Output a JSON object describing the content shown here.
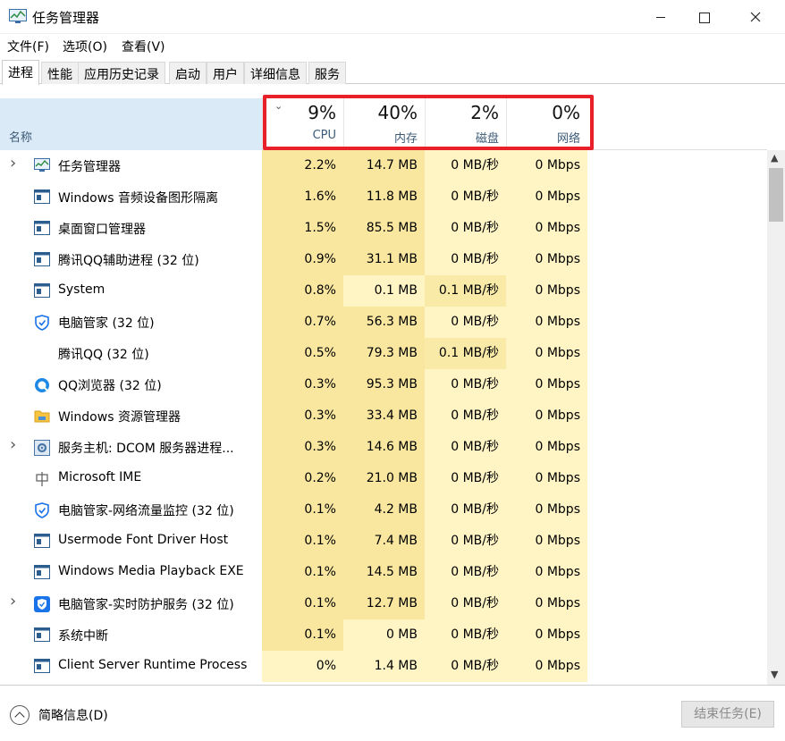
{
  "window": {
    "title": "任务管理器"
  },
  "menu": [
    "文件(F)",
    "选项(O)",
    "查看(V)"
  ],
  "tabs": [
    "进程",
    "性能",
    "应用历史记录",
    "启动",
    "用户",
    "详细信息",
    "服务"
  ],
  "active_tab": "进程",
  "columns": {
    "name": "名称",
    "cpu": {
      "percent": "9%",
      "label": "CPU"
    },
    "memory": {
      "percent": "40%",
      "label": "内存"
    },
    "disk": {
      "percent": "2%",
      "label": "磁盘"
    },
    "network": {
      "percent": "0%",
      "label": "网络"
    }
  },
  "processes": [
    {
      "name": "任务管理器",
      "icon": "task-manager-icon",
      "expandable": true,
      "cpu": "2.2%",
      "mem": "14.7 MB",
      "disk": "0 MB/秒",
      "net": "0 Mbps"
    },
    {
      "name": "Windows 音频设备图形隔离",
      "icon": "app-window-icon",
      "expandable": false,
      "cpu": "1.6%",
      "mem": "11.8 MB",
      "disk": "0 MB/秒",
      "net": "0 Mbps"
    },
    {
      "name": "桌面窗口管理器",
      "icon": "app-window-icon",
      "expandable": false,
      "cpu": "1.5%",
      "mem": "85.5 MB",
      "disk": "0 MB/秒",
      "net": "0 Mbps"
    },
    {
      "name": "腾讯QQ辅助进程 (32 位)",
      "icon": "app-window-icon",
      "expandable": false,
      "cpu": "0.9%",
      "mem": "31.1 MB",
      "disk": "0 MB/秒",
      "net": "0 Mbps"
    },
    {
      "name": "System",
      "icon": "app-window-icon",
      "expandable": false,
      "cpu": "0.8%",
      "mem": "0.1 MB",
      "disk": "0.1 MB/秒",
      "net": "0 Mbps"
    },
    {
      "name": "电脑管家 (32 位)",
      "icon": "shield-icon",
      "expandable": false,
      "cpu": "0.7%",
      "mem": "56.3 MB",
      "disk": "0 MB/秒",
      "net": "0 Mbps"
    },
    {
      "name": "腾讯QQ (32 位)",
      "icon": "",
      "expandable": false,
      "cpu": "0.5%",
      "mem": "79.3 MB",
      "disk": "0.1 MB/秒",
      "net": "0 Mbps"
    },
    {
      "name": "QQ浏览器 (32 位)",
      "icon": "browser-icon",
      "expandable": false,
      "cpu": "0.3%",
      "mem": "95.3 MB",
      "disk": "0 MB/秒",
      "net": "0 Mbps"
    },
    {
      "name": "Windows 资源管理器",
      "icon": "folder-icon",
      "expandable": false,
      "cpu": "0.3%",
      "mem": "33.4 MB",
      "disk": "0 MB/秒",
      "net": "0 Mbps"
    },
    {
      "name": "服务主机: DCOM 服务器进程...",
      "icon": "gear-icon",
      "expandable": true,
      "cpu": "0.3%",
      "mem": "14.6 MB",
      "disk": "0 MB/秒",
      "net": "0 Mbps"
    },
    {
      "name": "Microsoft IME",
      "icon": "ime-icon",
      "expandable": false,
      "cpu": "0.2%",
      "mem": "21.0 MB",
      "disk": "0 MB/秒",
      "net": "0 Mbps"
    },
    {
      "name": "电脑管家-网络流量监控 (32 位)",
      "icon": "shield-icon",
      "expandable": false,
      "cpu": "0.1%",
      "mem": "4.2 MB",
      "disk": "0 MB/秒",
      "net": "0 Mbps"
    },
    {
      "name": "Usermode Font Driver Host",
      "icon": "app-window-icon",
      "expandable": false,
      "cpu": "0.1%",
      "mem": "7.4 MB",
      "disk": "0 MB/秒",
      "net": "0 Mbps"
    },
    {
      "name": "Windows Media Playback EXE",
      "icon": "app-window-icon",
      "expandable": false,
      "cpu": "0.1%",
      "mem": "14.5 MB",
      "disk": "0 MB/秒",
      "net": "0 Mbps"
    },
    {
      "name": "电脑管家-实时防护服务 (32 位)",
      "icon": "shield-blue-icon",
      "expandable": true,
      "cpu": "0.1%",
      "mem": "12.7 MB",
      "disk": "0 MB/秒",
      "net": "0 Mbps"
    },
    {
      "name": "系统中断",
      "icon": "app-window-icon",
      "expandable": false,
      "cpu": "0.1%",
      "mem": "0 MB",
      "disk": "0 MB/秒",
      "net": "0 Mbps"
    },
    {
      "name": "Client Server Runtime Process",
      "icon": "app-window-icon",
      "expandable": false,
      "cpu": "0%",
      "mem": "1.4 MB",
      "disk": "0 MB/秒",
      "net": "0 Mbps"
    }
  ],
  "footer": {
    "fewer_details": "简略信息(D)",
    "end_task": "结束任务(E)"
  },
  "colors": {
    "heat_light": "#fff4c4",
    "heat_medium": "#f9eaa8",
    "heat_strong": "#f9e7a0",
    "header_bg": "#dbeaf7",
    "highlight": "#e8202a"
  }
}
